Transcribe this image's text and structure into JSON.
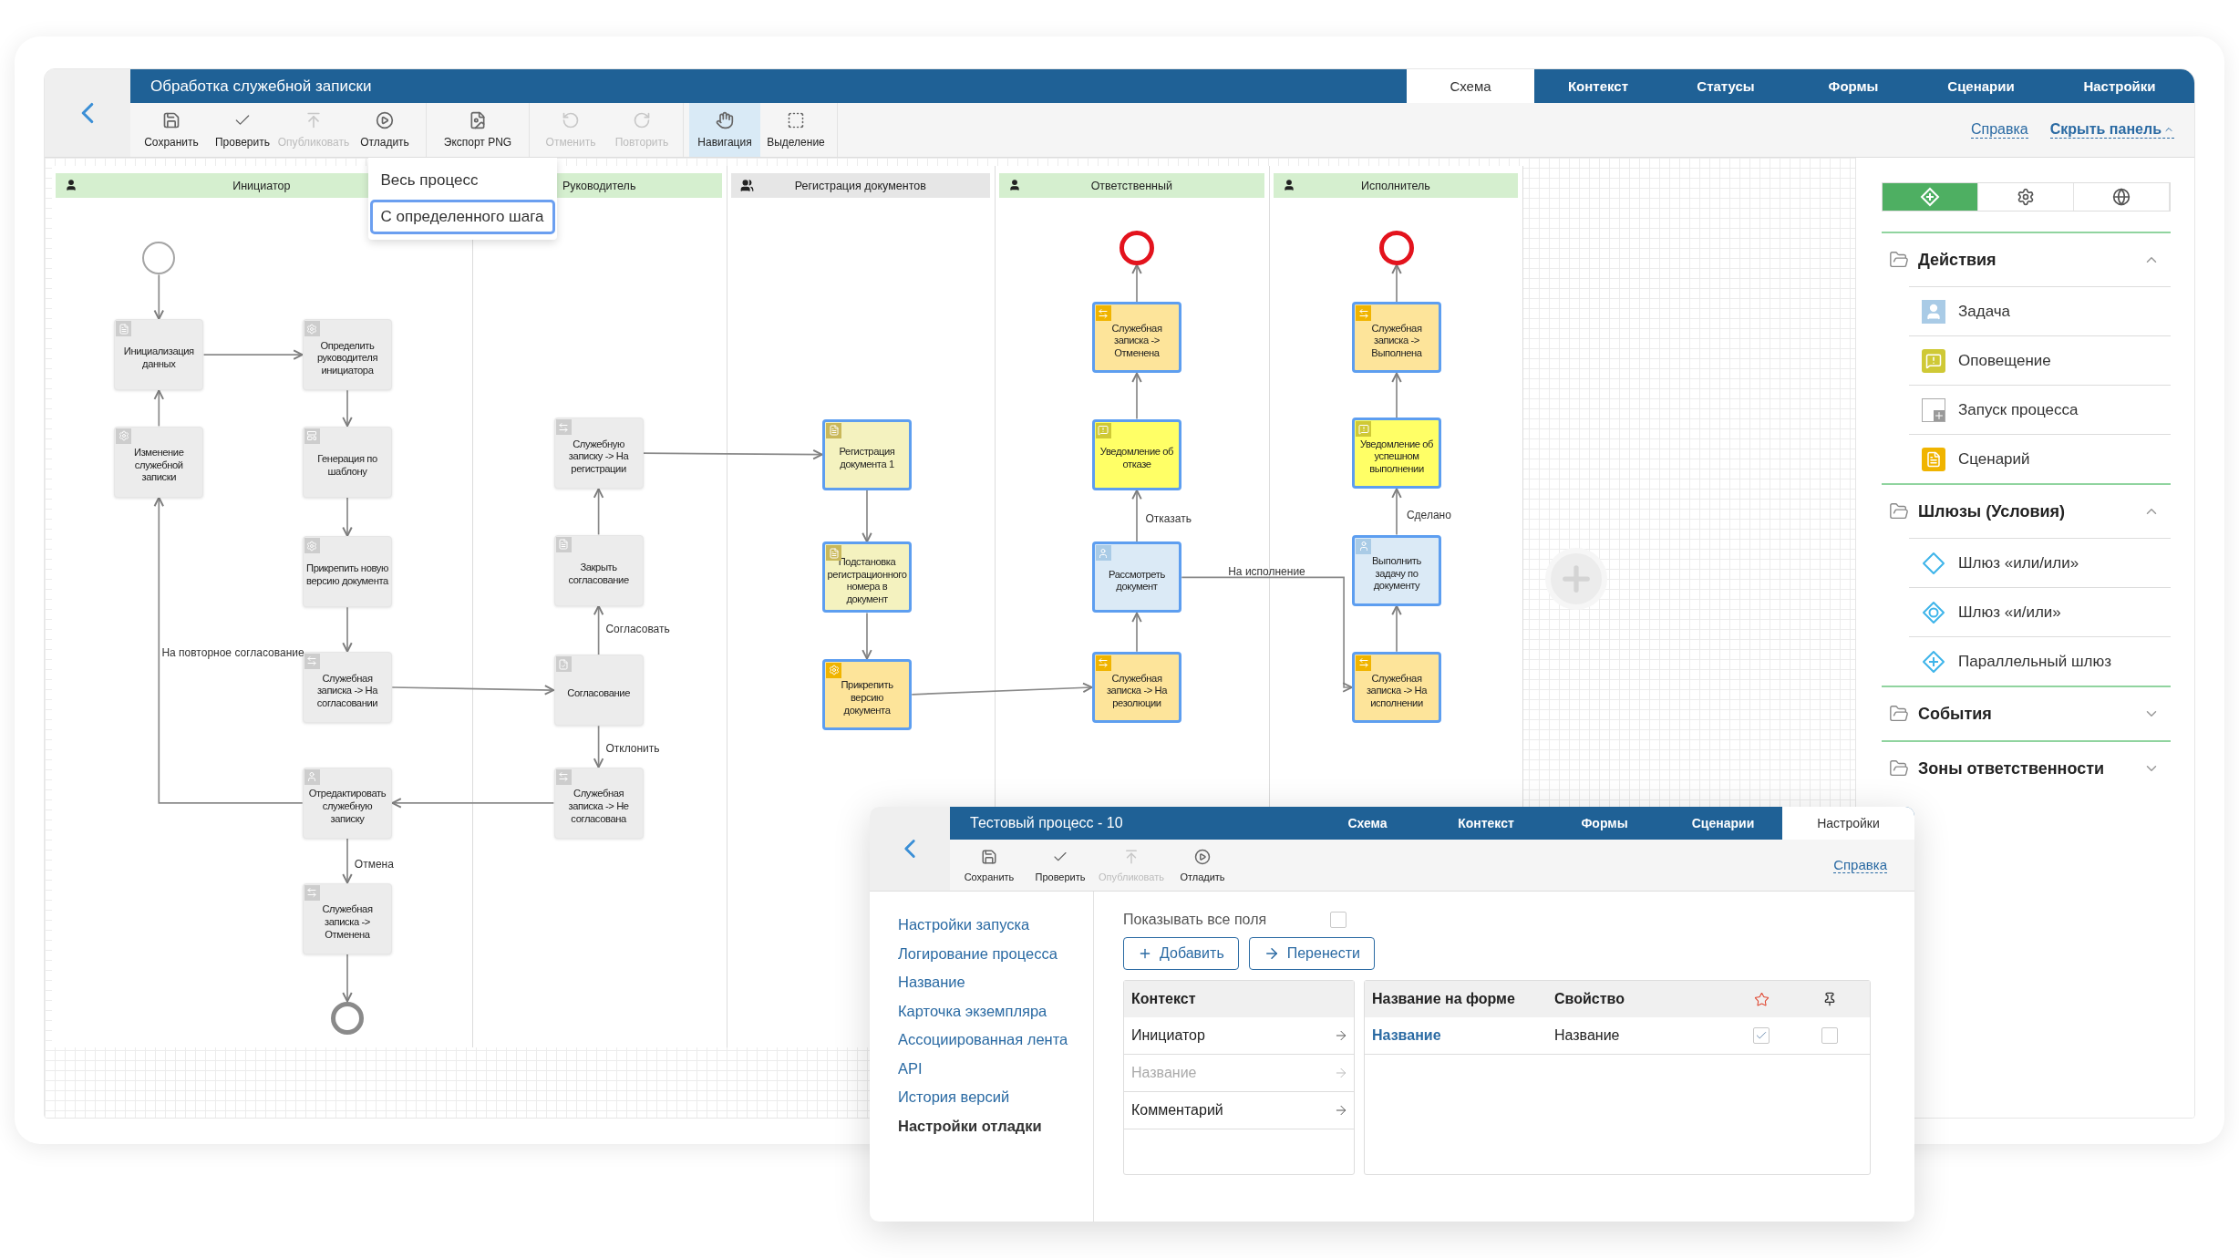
{
  "window": {
    "title": "Обработка служебной записки",
    "tabs": [
      {
        "label": "Схема",
        "selected": true
      },
      {
        "label": "Контекст",
        "selected": false
      },
      {
        "label": "Статусы",
        "selected": false
      },
      {
        "label": "Формы",
        "selected": false
      },
      {
        "label": "Сценарии",
        "selected": false
      },
      {
        "label": "Настройки",
        "selected": false
      }
    ]
  },
  "toolbar": {
    "groups": [
      [
        {
          "label": "Сохранить",
          "kind": "save",
          "disabled": false,
          "selected": false
        },
        {
          "label": "Проверить",
          "kind": "check",
          "disabled": false,
          "selected": false
        },
        {
          "label": "Опубликовать",
          "kind": "publish",
          "disabled": true,
          "selected": false
        },
        {
          "label": "Отладить",
          "kind": "debug",
          "disabled": false,
          "selected": false
        }
      ],
      [
        {
          "label": "Экспорт PNG",
          "kind": "export",
          "disabled": false,
          "selected": false
        }
      ],
      [
        {
          "label": "Отменить",
          "kind": "undo",
          "disabled": true,
          "selected": false
        },
        {
          "label": "Повторить",
          "kind": "redo",
          "disabled": true,
          "selected": false
        }
      ],
      [
        {
          "label": "Навигация",
          "kind": "navigate",
          "disabled": false,
          "selected": true
        },
        {
          "label": "Выделение",
          "kind": "select",
          "disabled": false,
          "selected": false
        }
      ]
    ],
    "links": [
      {
        "label": "Справка",
        "kind": "link"
      },
      {
        "label": "Скрыть панель",
        "kind": "toggle"
      }
    ]
  },
  "scope_menu": {
    "items": [
      {
        "label": "Весь процесс",
        "selected": false
      },
      {
        "label": "С определенного шага",
        "selected": true
      }
    ]
  },
  "lanes": [
    {
      "name": "Инициатор",
      "kind": "person",
      "highlighted": true
    },
    {
      "name": "Руководитель",
      "highlighted": true
    },
    {
      "name": "Регистрация документов",
      "kind": "group",
      "highlighted": false
    },
    {
      "name": "Ответственный",
      "kind": "person",
      "highlighted": true
    },
    {
      "name": "Исполнитель",
      "kind": "person",
      "highlighted": true
    }
  ],
  "events": [
    {
      "kind": "start",
      "active": false
    },
    {
      "kind": "end",
      "active": false
    },
    {
      "kind": "end",
      "active": true
    },
    {
      "kind": "end",
      "active": true
    }
  ],
  "nodes": [
    {
      "label": "Инициализация данных",
      "kind": "document",
      "active": false
    },
    {
      "label": "Определить руководителя инициатора",
      "kind": "script",
      "active": false
    },
    {
      "label": "Изменение служебной записки",
      "kind": "script",
      "active": false
    },
    {
      "label": "Генерация по шаблону",
      "kind": "template",
      "active": false
    },
    {
      "label": "Прикрепить новую версию документа",
      "kind": "script",
      "active": false
    },
    {
      "label": "Служебная записка -> На согласовании",
      "kind": "status",
      "active": false
    },
    {
      "label": "Отредактировать служебную записку",
      "kind": "task",
      "active": false
    },
    {
      "label": "Служебная записка -> Отменена",
      "kind": "status",
      "active": false
    },
    {
      "label": "Служебную записку -> На регистрации",
      "kind": "status",
      "active": false
    },
    {
      "label": "Закрыть согласование",
      "kind": "document",
      "active": false
    },
    {
      "label": "Согласование",
      "kind": "approval",
      "active": false
    },
    {
      "label": "Служебная записка -> Не согласована",
      "kind": "status",
      "active": false
    },
    {
      "label": "Регистрация документа 1",
      "kind": "document",
      "active": true
    },
    {
      "label": "Подстановка регистрационного номера в документ",
      "kind": "document",
      "active": true
    },
    {
      "label": "Прикрепить версию документа",
      "kind": "script",
      "active": true
    },
    {
      "label": "Служебная записка -> Отменена",
      "kind": "status",
      "active": true
    },
    {
      "label": "Уведомление об отказе",
      "kind": "notification",
      "active": true
    },
    {
      "label": "Рассмотреть документ",
      "kind": "task",
      "active": true
    },
    {
      "label": "Служебная записка -> На резолюции",
      "kind": "status",
      "active": true
    },
    {
      "label": "Служебная записка -> Выполнена",
      "kind": "status",
      "active": true
    },
    {
      "label": "Уведомление об успешном выполнении",
      "kind": "notification",
      "active": true
    },
    {
      "label": "Выполнить задачу по документу",
      "kind": "task",
      "active": true
    },
    {
      "label": "Служебная записка -> На исполнении",
      "kind": "status",
      "active": true
    }
  ],
  "edge_labels": [
    "На повторное согласование",
    "Согласовать",
    "Отклонить",
    "Отмена",
    "Отказать",
    "На исполнение",
    "Сделано"
  ],
  "palette": {
    "tabs": [
      {
        "kind": "elements",
        "selected": true
      },
      {
        "kind": "settings",
        "selected": false
      },
      {
        "kind": "globe",
        "selected": false
      }
    ],
    "sections": [
      {
        "title": "Действия",
        "expanded": true,
        "items": [
          {
            "label": "Задача",
            "kind": "task"
          },
          {
            "label": "Оповещение",
            "kind": "notification"
          },
          {
            "label": "Запуск процесса",
            "kind": "subprocess"
          },
          {
            "label": "Сценарий",
            "kind": "script"
          }
        ]
      },
      {
        "title": "Шлюзы (Условия)",
        "expanded": true,
        "items": [
          {
            "label": "Шлюз «или/или»",
            "kind": "xor"
          },
          {
            "label": "Шлюз «и/или»",
            "kind": "or"
          },
          {
            "label": "Параллельный шлюз",
            "kind": "parallel"
          }
        ]
      },
      {
        "title": "События",
        "expanded": false
      },
      {
        "title": "Зоны ответственности",
        "expanded": false
      }
    ]
  },
  "settings_window": {
    "title": "Тестовый процесс - 10",
    "tabs": [
      {
        "label": "Схема",
        "selected": false
      },
      {
        "label": "Контекст",
        "selected": false
      },
      {
        "label": "Формы",
        "selected": false
      },
      {
        "label": "Сценарии",
        "selected": false
      },
      {
        "label": "Настройки",
        "selected": true
      }
    ],
    "toolbar": [
      {
        "label": "Сохранить",
        "kind": "save",
        "disabled": false
      },
      {
        "label": "Проверить",
        "kind": "check",
        "disabled": false
      },
      {
        "label": "Опубликовать",
        "kind": "publish",
        "disabled": true
      },
      {
        "label": "Отладить",
        "kind": "debug",
        "disabled": false
      }
    ],
    "help_link": "Справка",
    "nav": [
      {
        "label": "Настройки запуска",
        "selected": false
      },
      {
        "label": "Логирование процесса",
        "selected": false
      },
      {
        "label": "Название",
        "selected": false
      },
      {
        "label": "Карточка экземпляра",
        "selected": false
      },
      {
        "label": "Ассоциированная лента",
        "selected": false
      },
      {
        "label": "API",
        "selected": false
      },
      {
        "label": "История версий",
        "selected": false
      },
      {
        "label": "Настройки отладки",
        "selected": true
      }
    ],
    "show_all": {
      "label": "Показывать все поля",
      "checked": false
    },
    "buttons": [
      {
        "label": "Добавить",
        "kind": "add"
      },
      {
        "label": "Перенести",
        "kind": "move"
      }
    ],
    "context_table": {
      "title": "Контекст",
      "rows": [
        {
          "label": "Инициатор",
          "disabled": false
        },
        {
          "label": "Название",
          "disabled": true
        },
        {
          "label": "Комментарий",
          "disabled": false
        }
      ]
    },
    "form_table": {
      "columns": [
        "Название на форме",
        "Свойство"
      ],
      "rows": [
        {
          "name": "Название",
          "property": "Название",
          "starred": true,
          "pinned": false
        }
      ]
    }
  }
}
